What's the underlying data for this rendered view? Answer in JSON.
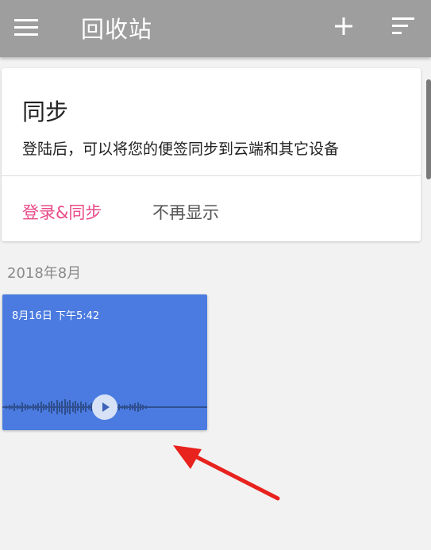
{
  "appbar": {
    "title": "回收站",
    "menu_icon": "hamburger-menu-icon",
    "add_icon": "plus-icon",
    "sort_icon": "sort-lines-icon",
    "background": "#9e9e9e"
  },
  "sync_card": {
    "heading": "同步",
    "description": "登陆后，可以将您的便签同步到云端和其它设备",
    "login_label": "登录&同步",
    "dismiss_label": "不再显示",
    "accent": "#e84b88"
  },
  "section": {
    "date_header": "2018年8月"
  },
  "voice_note": {
    "timestamp": "8月16日 下午5:42",
    "color": "#4b7be0",
    "play_icon": "play-icon"
  },
  "annotation": {
    "arrow_color": "#e8221d"
  }
}
